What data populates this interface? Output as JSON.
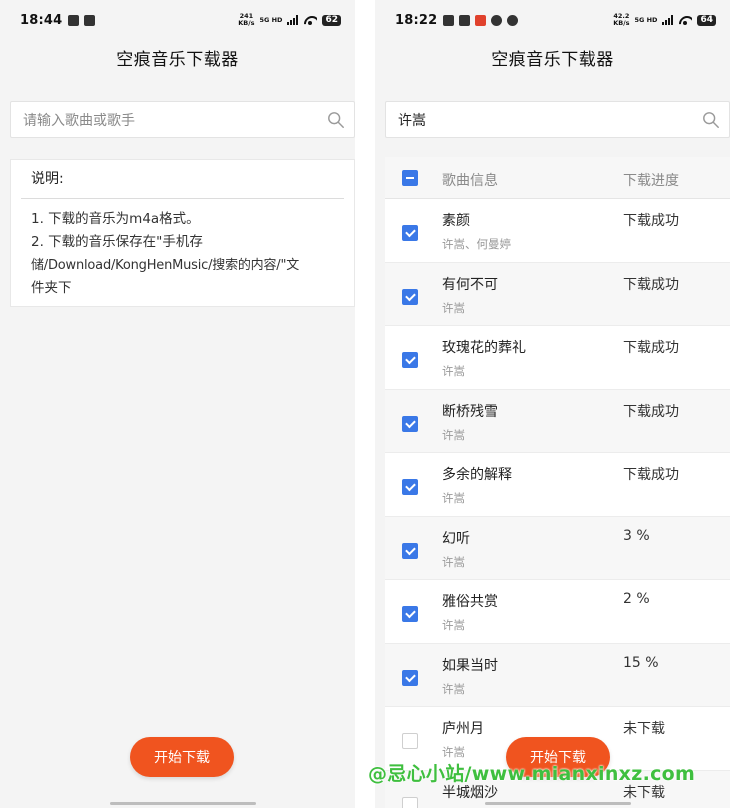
{
  "left": {
    "status": {
      "time": "18:44",
      "net_speed": "241\nKB/s",
      "net_type": "5G HD",
      "battery": "62"
    },
    "title": "空痕音乐下载器",
    "search": {
      "placeholder": "请输入歌曲或歌手",
      "value": ""
    },
    "info": {
      "heading": "说明:",
      "lines": [
        "1. 下载的音乐为m4a格式。",
        "2. 下载的音乐保存在\"手机存",
        "储/Download/KongHenMusic/搜索的内容/\"文",
        "件夹下"
      ]
    },
    "start_button": "开始下载"
  },
  "right": {
    "status": {
      "time": "18:22",
      "net_speed": "42.2\nKB/s",
      "net_type": "5G HD",
      "battery": "64"
    },
    "title": "空痕音乐下载器",
    "search": {
      "placeholder": "",
      "value": "许嵩"
    },
    "table": {
      "header": {
        "song": "歌曲信息",
        "progress": "下载进度"
      },
      "rows": [
        {
          "name": "素颜",
          "artist": "许嵩、何曼婷",
          "progress": "下载成功",
          "checked": true
        },
        {
          "name": "有何不可",
          "artist": "许嵩",
          "progress": "下载成功",
          "checked": true
        },
        {
          "name": "玫瑰花的葬礼",
          "artist": "许嵩",
          "progress": "下载成功",
          "checked": true
        },
        {
          "name": "断桥残雪",
          "artist": "许嵩",
          "progress": "下载成功",
          "checked": true
        },
        {
          "name": "多余的解释",
          "artist": "许嵩",
          "progress": "下载成功",
          "checked": true
        },
        {
          "name": "幻听",
          "artist": "许嵩",
          "progress": "3 %",
          "checked": true
        },
        {
          "name": "雅俗共赏",
          "artist": "许嵩",
          "progress": "2 %",
          "checked": true
        },
        {
          "name": "如果当时",
          "artist": "许嵩",
          "progress": "15 %",
          "checked": true
        },
        {
          "name": "庐州月",
          "artist": "许嵩",
          "progress": "未下载",
          "checked": false
        },
        {
          "name": "半城烟沙",
          "artist": "",
          "progress": "未下载",
          "checked": false
        }
      ]
    },
    "start_button": "开始下载"
  },
  "watermark": "@忌心小站/www.mianxinxz.com",
  "colors": {
    "accent": "#f0541f",
    "checkbox": "#3a78e7",
    "watermark": "#3fbf3f"
  }
}
